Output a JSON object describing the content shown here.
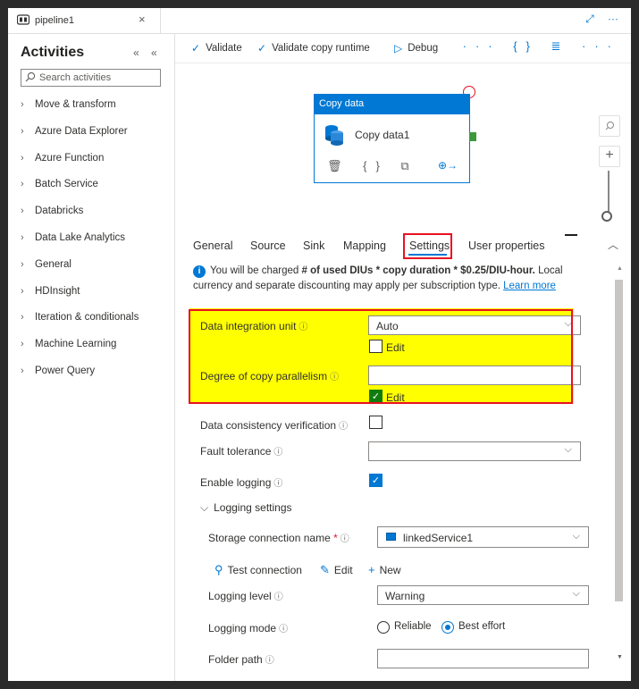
{
  "tab": {
    "title": "pipeline1",
    "close": "×",
    "icons": "⤢ ⋯"
  },
  "activities": {
    "title": "Activities",
    "controls": "« «",
    "search_placeholder": "Search activities",
    "categories": [
      "Move & transform",
      "Azure Data Explorer",
      "Azure Function",
      "Batch Service",
      "Databricks",
      "Data Lake Analytics",
      "General",
      "HDInsight",
      "Iteration & conditionals",
      "Machine Learning",
      "Power Query"
    ]
  },
  "toolbar": {
    "validate": "Validate",
    "validate_runtime": "Validate copy runtime",
    "debug": "Debug",
    "right_icons": "··· {} ≣ ···"
  },
  "node": {
    "type": "Copy data",
    "name": "Copy data1",
    "actions": "🗑 {} ⧉",
    "go": "⊕→"
  },
  "property_tabs": [
    "General",
    "Source",
    "Sink",
    "Mapping",
    "Settings",
    "User properties"
  ],
  "active_tab": "Settings",
  "info": {
    "prefix": "You will be charged ",
    "bold": "# of used DIUs * copy duration * $0.25/DIU-hour.",
    "suffix": " Local currency and separate discounting may apply per subscription type. ",
    "link": "Learn more"
  },
  "settings": {
    "diu_label": "Data integration unit",
    "diu_value": "Auto",
    "diu_edit": "Edit",
    "parallelism_label": "Degree of copy parallelism",
    "parallelism_value": "",
    "parallelism_edit": "Edit",
    "consistency_label": "Data consistency verification",
    "fault_label": "Fault tolerance",
    "fault_value": "",
    "logging_label": "Enable logging",
    "logging_settings": "Logging settings",
    "storage_label": "Storage connection name",
    "storage_required": "*",
    "storage_value": "linkedService1",
    "test_connection": "Test connection",
    "edit": "Edit",
    "new": "New",
    "level_label": "Logging level",
    "level_value": "Warning",
    "mode_label": "Logging mode",
    "mode_reliable": "Reliable",
    "mode_best": "Best effort",
    "folder_label": "Folder path",
    "folder_value": ""
  }
}
